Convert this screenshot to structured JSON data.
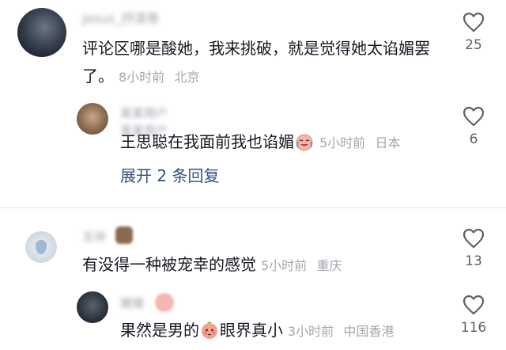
{
  "comments": [
    {
      "username": "Jesus_抒清等",
      "text": "评论区哪是酸她，我来挑破，就是觉得她太谄媚罢了。",
      "time": "8小时前",
      "location": "北京",
      "likes": "25"
    },
    {
      "username": "某某用户",
      "username_line2": "某某用户",
      "text": "王思聪在我面前我也谄媚",
      "emoji": "crying-laughing-emoji",
      "time": "5小时前",
      "location": "日本",
      "likes": "6"
    },
    {
      "username": "五块",
      "text": "有没得一种被宠幸的感觉",
      "time": "5小时前",
      "location": "重庆",
      "likes": "13"
    },
    {
      "username": "猪猪",
      "text_before": "果然是男的",
      "emoji": "blushing-face-emoji",
      "text_after": "眼界真小",
      "time": "3小时前",
      "location": "中国香港",
      "likes": "116"
    }
  ],
  "expand_replies": "展开 2 条回复",
  "colors": {
    "text": "#161823",
    "meta": "#a4a7ad",
    "link": "#344d82",
    "like_icon": "#5f6168"
  }
}
